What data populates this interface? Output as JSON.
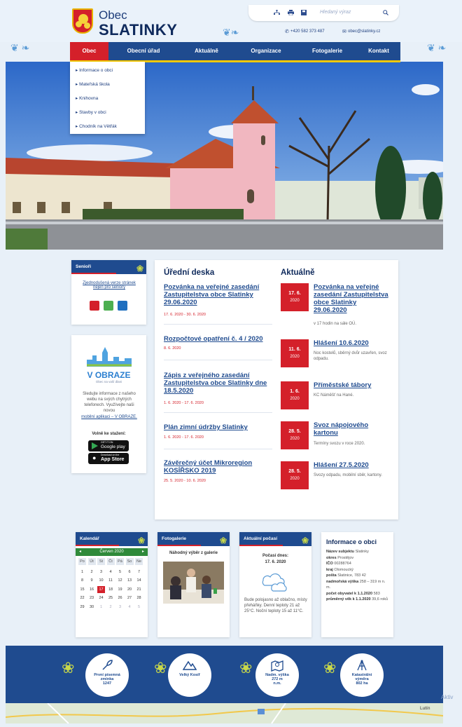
{
  "header": {
    "brand_top": "Obec",
    "brand_name": "SLATINKY",
    "search_placeholder": "Hledaný výraz",
    "phone": "+420 582 373 487",
    "email": "obec@slatinky.cz"
  },
  "nav": {
    "items": [
      "Obec",
      "Obecní úřad",
      "Aktuálně",
      "Organizace",
      "Fotogalerie",
      "Kontakt"
    ],
    "dropdown": [
      "Informace o obci",
      "Mateřská škola",
      "Knihovna",
      "Stavby v obci",
      "Chodník na Větřák"
    ]
  },
  "seniori": {
    "title": "Senioři",
    "link": "Zjednodušená verze stránek nejen pro seniory"
  },
  "vobraze": {
    "brand": "V OBRAZE",
    "tagline": "Obec na vaší dlani",
    "text": "Sledujte informace z našeho webu na svých chytrých telefonech. Využívejte naši novou",
    "link": "mobilní aplikaci – V OBRAZE.",
    "download": "Volně ke stažení:",
    "google_small": "GET IT ON",
    "google": "Google play",
    "apple_small": "Download on the",
    "apple": "App Store"
  },
  "uredni_deska": {
    "heading": "Úřední deska",
    "items": [
      {
        "title": "Pozvánka na veřejné zasedání Zastupitelstva obce Slatinky 29.06.2020",
        "date": "17. 6. 2020 - 30. 6. 2020"
      },
      {
        "title": "Rozpočtové opatření č. 4 / 2020",
        "date": "8. 6. 2020"
      },
      {
        "title": "Zápis z veřejného zasedání Zastupitelstva obce Slatinky dne 18.5.2020",
        "date": "1. 6. 2020 - 17. 6. 2020"
      },
      {
        "title": "Plán zimní údržby Slatinky",
        "date": "1. 6. 2020 - 17. 6. 2020"
      },
      {
        "title": "Závěrečný účet Mikroregion KOSÍŘSKO 2019",
        "date": "25. 5. 2020 - 10. 6. 2020"
      }
    ]
  },
  "aktualne": {
    "heading": "Aktuálně",
    "items": [
      {
        "day": "17. 6.",
        "year": "2020",
        "title": "Pozvánka na veřejné zasedání Zastupitelstva obce Slatinky 29.06.2020",
        "desc": "v 17 hodin na sále OÚ."
      },
      {
        "day": "11. 6.",
        "year": "2020",
        "title": "Hlášení 10.6.2020",
        "desc": "Noc kostelů, sběrný dvůr uzavřen, svoz odpadu."
      },
      {
        "day": "1. 6.",
        "year": "2020",
        "title": "Příměstské tábory",
        "desc": "KC Náměšť na Hané."
      },
      {
        "day": "28. 5.",
        "year": "2020",
        "title": "Svoz nápojového kartonu",
        "desc": "Termíny svozu v roce 2020."
      },
      {
        "day": "28. 5.",
        "year": "2020",
        "title": "Hlášení 27.5.2020",
        "desc": "Svozy odpadu, mobilní sběr, kartony."
      }
    ]
  },
  "kalendar": {
    "title": "Kalendář",
    "month": "Červen 2020",
    "days": [
      "Po",
      "Út",
      "St",
      "Čt",
      "Pá",
      "So",
      "Ne"
    ],
    "weeks": [
      [
        "1",
        "2",
        "3",
        "4",
        "5",
        "6",
        "7"
      ],
      [
        "8",
        "9",
        "10",
        "11",
        "12",
        "13",
        "14"
      ],
      [
        "15",
        "16",
        "17",
        "18",
        "19",
        "20",
        "21"
      ],
      [
        "22",
        "23",
        "24",
        "25",
        "26",
        "27",
        "28"
      ],
      [
        "29",
        "30",
        "1",
        "2",
        "3",
        "4",
        "5"
      ]
    ],
    "today": "17"
  },
  "fotogalerie": {
    "title": "Fotogalerie",
    "caption": "Náhodný výběr z galerie"
  },
  "pocasi": {
    "title": "Aktuální počasí",
    "today": "Počasí dnes:",
    "date": "17. 6. 2020",
    "text": "Bude polojasno až oblačno, místy přeháňky. Denní teploty 21 až 25°C. Noční teploty 15 až 11°C."
  },
  "info": {
    "heading": "Informace o obci",
    "rows": [
      {
        "label": "Název subjektu",
        "value": "Slatinky"
      },
      {
        "label": "okres",
        "value": "Prostějov"
      },
      {
        "label": "IČO",
        "value": "00288764"
      },
      {
        "label": "kraj",
        "value": "Olomoucký"
      },
      {
        "label": "pošta",
        "value": "Slatinice, 783 42"
      },
      {
        "label": "nadmořská výška",
        "value": "258 – 319 m n. m."
      },
      {
        "label": "počet obyvatel k 1.1.2020",
        "value": "583"
      },
      {
        "label": "průměrný věk k 1.1.2020",
        "value": "39,6 roků"
      }
    ]
  },
  "stats": [
    {
      "line1": "První písemná",
      "line2": "zmínka",
      "line3": "1247",
      "icon": "quill-icon"
    },
    {
      "line1": "Velký Kosíř",
      "line2": "",
      "line3": "",
      "icon": "mountain-icon"
    },
    {
      "line1": "Nadm. výška",
      "line2": "272 m",
      "line3": "n.m.",
      "icon": "map-pin-icon"
    },
    {
      "line1": "Katastrální",
      "line2": "výměra",
      "line3": "802 ha",
      "icon": "surveyor-icon"
    }
  ],
  "map": {
    "place": "Lutín"
  },
  "watermark": "Aktiv"
}
